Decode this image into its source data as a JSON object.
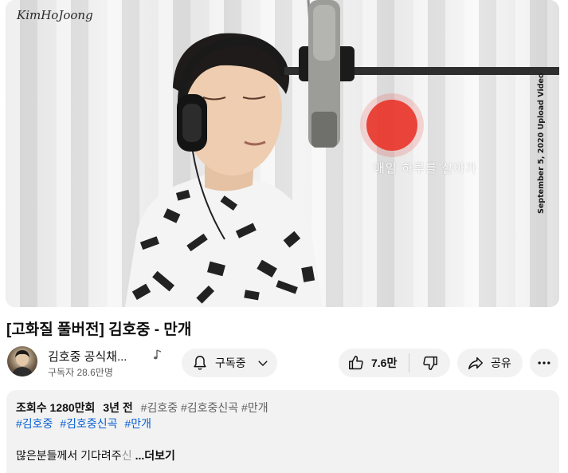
{
  "player": {
    "watermark": "KimHoJoong",
    "caption": "매일 하루를 살아가",
    "upload_note": "September 5, 2020 Upload Video"
  },
  "video": {
    "title": "[고화질 풀버전] 김호중 - 만개"
  },
  "channel": {
    "name": "김호중 공식채...",
    "subscribers": "구독자 28.6만명",
    "music_icon": "music-note-icon"
  },
  "actions": {
    "subscribe_label": "구독중",
    "like_count": "7.6만",
    "share_label": "공유",
    "icons": {
      "bell": "bell-icon",
      "chevron": "chevron-down-icon",
      "like": "thumbs-up-icon",
      "dislike": "thumbs-down-icon",
      "share": "share-icon",
      "more": "more-horizontal-icon"
    }
  },
  "description": {
    "views": "조회수 1280만회",
    "age": "3년 전",
    "header_tags": "#김호중 #김호중신곡 #만개",
    "tags": [
      "#김호중",
      "#김호중신곡",
      "#만개"
    ],
    "body": "많은분들께서 기다려주",
    "body_fade": "신",
    "more_label": "...더보기"
  },
  "colors": {
    "accent_link": "#065fd4",
    "pill_bg": "#f2f2f2",
    "record_light": "#e8372e"
  }
}
